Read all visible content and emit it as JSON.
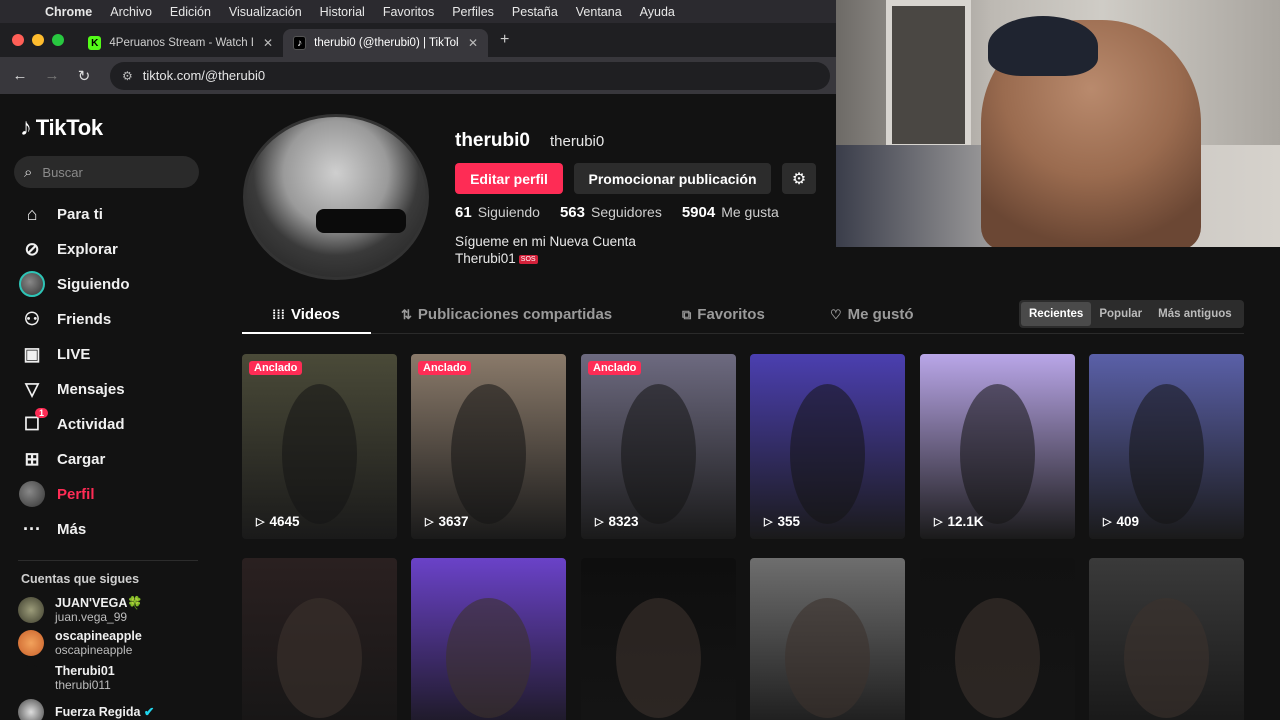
{
  "menubar": {
    "apple": "",
    "items": [
      "Chrome",
      "Archivo",
      "Edición",
      "Visualización",
      "Historial",
      "Favoritos",
      "Perfiles",
      "Pestaña",
      "Ventana",
      "Ayuda"
    ]
  },
  "browser": {
    "tabs": [
      {
        "title": "4Peruanos Stream - Watch Li",
        "favicon": "K",
        "favicon_color": "#53fc18"
      },
      {
        "title": "therubi0 (@therubi0) | TikTok",
        "favicon": "♪",
        "favicon_color": "#000000"
      }
    ],
    "url": "tiktok.com/@therubi0"
  },
  "sidebar": {
    "logo": "TikTok",
    "search_placeholder": "Buscar",
    "nav": [
      {
        "label": "Para ti",
        "icon": "home-icon"
      },
      {
        "label": "Explorar",
        "icon": "compass-icon"
      },
      {
        "label": "Siguiendo",
        "icon": "following-avatar-icon"
      },
      {
        "label": "Friends",
        "icon": "friends-icon"
      },
      {
        "label": "LIVE",
        "icon": "live-tv-icon"
      },
      {
        "label": "Mensajes",
        "icon": "send-icon"
      },
      {
        "label": "Actividad",
        "icon": "inbox-icon",
        "badge": "1"
      },
      {
        "label": "Cargar",
        "icon": "plus-square-icon"
      },
      {
        "label": "Perfil",
        "icon": "profile-avatar-icon"
      },
      {
        "label": "Más",
        "icon": "more-icon"
      }
    ],
    "following_title": "Cuentas que sigues",
    "following": [
      {
        "name": "JUAN'VEGA🍀",
        "handle": "juan.vega_99"
      },
      {
        "name": "oscapineapple",
        "handle": "oscapineapple"
      },
      {
        "name": "Therubi01",
        "handle": "therubi011"
      },
      {
        "name": "Fuerza Regida",
        "handle": ""
      }
    ]
  },
  "profile": {
    "username": "therubi0",
    "nickname": "therubi0",
    "edit_label": "Editar perfil",
    "promote_label": "Promocionar publicación",
    "stats": [
      {
        "value": "61",
        "label": "Siguiendo"
      },
      {
        "value": "563",
        "label": "Seguidores"
      },
      {
        "value": "5904",
        "label": "Me gusta"
      }
    ],
    "bio_line1": "Sígueme en mi Nueva Cuenta",
    "bio_line2": "Therubi01",
    "bio_emoji": "SOS"
  },
  "content_tabs": [
    {
      "label": "Videos",
      "icon": "grid-icon"
    },
    {
      "label": "Publicaciones compartidas",
      "icon": "repost-icon"
    },
    {
      "label": "Favoritos",
      "icon": "bookmark-icon"
    },
    {
      "label": "Me gustó",
      "icon": "heart-outline-icon"
    }
  ],
  "sort": [
    "Recientes",
    "Popular",
    "Más antiguos"
  ],
  "pinned_label": "Anclado",
  "videos_row1": [
    {
      "views": "4645",
      "pinned": true,
      "bg": "#4a4a38"
    },
    {
      "views": "3637",
      "pinned": true,
      "bg": "#8a7a6a"
    },
    {
      "views": "8323",
      "pinned": true,
      "bg": "#6d6a80"
    },
    {
      "views": "355",
      "pinned": false,
      "bg": "#4b3fb0"
    },
    {
      "views": "12.1K",
      "pinned": false,
      "bg": "#b9a6e8"
    },
    {
      "views": "409",
      "pinned": false,
      "bg": "#5a60a8"
    }
  ],
  "videos_row2": [
    {
      "bg": "#2a2020"
    },
    {
      "bg": "#6a42c8"
    },
    {
      "bg": "#0e0e0e"
    },
    {
      "bg": "#6e6e6e"
    },
    {
      "bg": "#111111"
    },
    {
      "bg": "#3a3a3a"
    }
  ]
}
